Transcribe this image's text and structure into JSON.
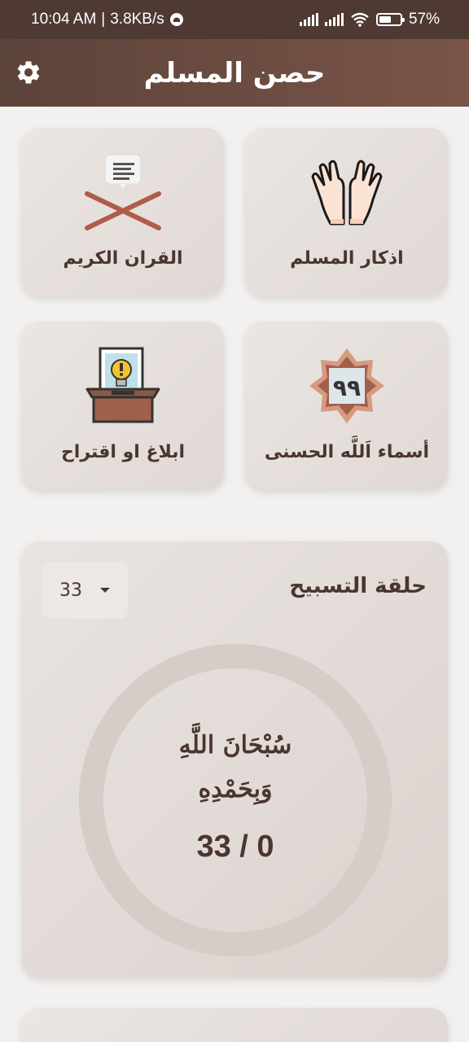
{
  "status_bar": {
    "time": "10:04 AM",
    "speed": "3.8KB/s",
    "battery": "57%",
    "battery_level": 0.57
  },
  "app_bar": {
    "title": "حصن المسلم",
    "settings_icon": "gear-icon"
  },
  "menu": {
    "adhkar": {
      "label": "اذكار المسلم",
      "icon": "praying-hands-icon"
    },
    "quran": {
      "label": "القران الكريم",
      "icon": "open-quran-icon"
    },
    "names": {
      "label": "أسماء اَللَّه الحسنى",
      "icon": "ninety-nine-star-icon",
      "badge": "٩٩"
    },
    "report": {
      "label": "ابلاغ او اقتراح",
      "icon": "suggestion-box-icon"
    }
  },
  "tasbeeh": {
    "title": "حلقة التسبيح",
    "count_selected": "33",
    "dhikr_line1": "سُبْحَانَ اللَّهِ",
    "dhikr_line2": "وَبِحَمْدِهِ",
    "counter": "33 / 0"
  },
  "colors": {
    "primary": "#5c433a",
    "text": "#4a3530",
    "ring": "#d6ccc8"
  }
}
